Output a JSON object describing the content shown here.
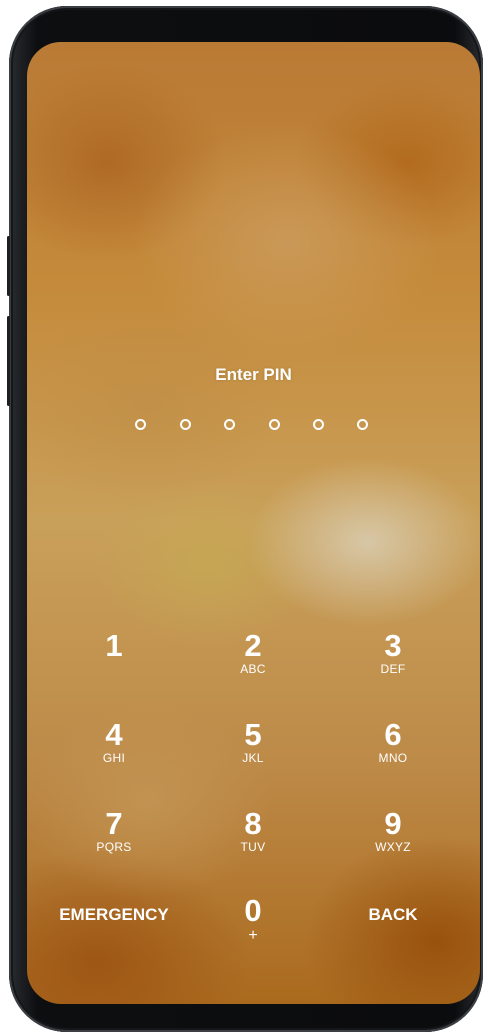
{
  "lock_screen": {
    "title": "Enter PIN",
    "pin_slots": 6
  },
  "keypad": {
    "keys": [
      {
        "number": "1",
        "letters": ""
      },
      {
        "number": "2",
        "letters": "ABC"
      },
      {
        "number": "3",
        "letters": "DEF"
      },
      {
        "number": "4",
        "letters": "GHI"
      },
      {
        "number": "5",
        "letters": "JKL"
      },
      {
        "number": "6",
        "letters": "MNO"
      },
      {
        "number": "7",
        "letters": "PQRS"
      },
      {
        "number": "8",
        "letters": "TUV"
      },
      {
        "number": "9",
        "letters": "WXYZ"
      },
      {
        "number": "0",
        "letters": "+"
      }
    ],
    "emergency_label": "EMERGENCY",
    "back_label": "BACK"
  },
  "colors": {
    "text": "#ffffff",
    "frame": "#0b0c0e",
    "wallpaper_base": "#c58a3a"
  }
}
